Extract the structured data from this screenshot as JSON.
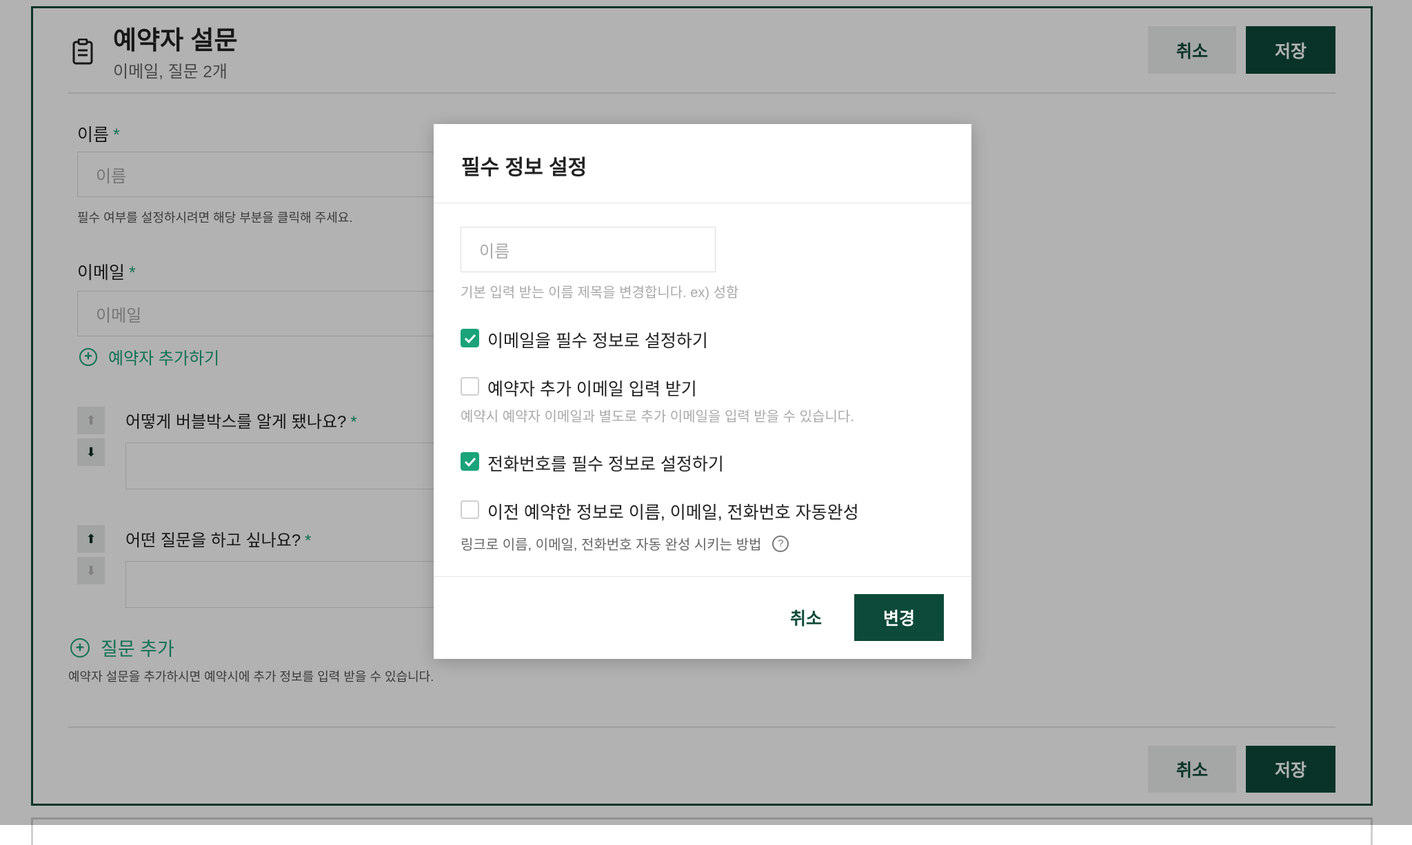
{
  "header": {
    "title": "예약자 설문",
    "subtitle": "이메일, 질문 2개",
    "cancel_label": "취소",
    "save_label": "저장"
  },
  "form": {
    "name_label": "이름",
    "name_placeholder": "이름",
    "name_help": "필수 여부를 설정하시려면 해당 부분을 클릭해 주세요.",
    "email_label": "이메일",
    "email_placeholder": "이메일",
    "add_booker_label": "예약자 추가하기",
    "required_mark": "*"
  },
  "questions": [
    {
      "label": "어떻게 버블박스를 알게 됐나요?"
    },
    {
      "label": "어떤 질문을 하고 싶나요?"
    }
  ],
  "add_question": {
    "label": "질문 추가",
    "help": "예약자 설문을 추가하시면 예약시에 추가 정보를 입력 받을 수 있습니다."
  },
  "footer": {
    "cancel_label": "취소",
    "save_label": "저장"
  },
  "modal": {
    "title": "필수 정보 설정",
    "name_placeholder": "이름",
    "name_help": "기본 입력 받는 이름 제목을 변경합니다. ex) 성함",
    "options": [
      {
        "label": "이메일을 필수 정보로 설정하기",
        "checked": true,
        "help": ""
      },
      {
        "label": "예약자 추가 이메일 입력 받기",
        "checked": false,
        "help": "예약시 예약자 이메일과 별도로 추가 이메일을 입력 받을 수 있습니다."
      },
      {
        "label": "전화번호를 필수 정보로 설정하기",
        "checked": true,
        "help": ""
      },
      {
        "label": "이전 예약한 정보로 이름, 이메일, 전화번호 자동완성",
        "checked": false,
        "help": "링크로 이름, 이메일, 전화번호 자동 완성 시키는 방법"
      }
    ],
    "cancel_label": "취소",
    "change_label": "변경"
  },
  "colors": {
    "primary": "#0d4a3a",
    "accent": "#1aa37a",
    "overlay": "rgba(0,0,0,0.30)"
  },
  "icons": [
    "clipboard-icon",
    "plus-circle-icon",
    "arrow-up-icon",
    "arrow-down-icon",
    "checkmark-icon",
    "question-icon"
  ]
}
